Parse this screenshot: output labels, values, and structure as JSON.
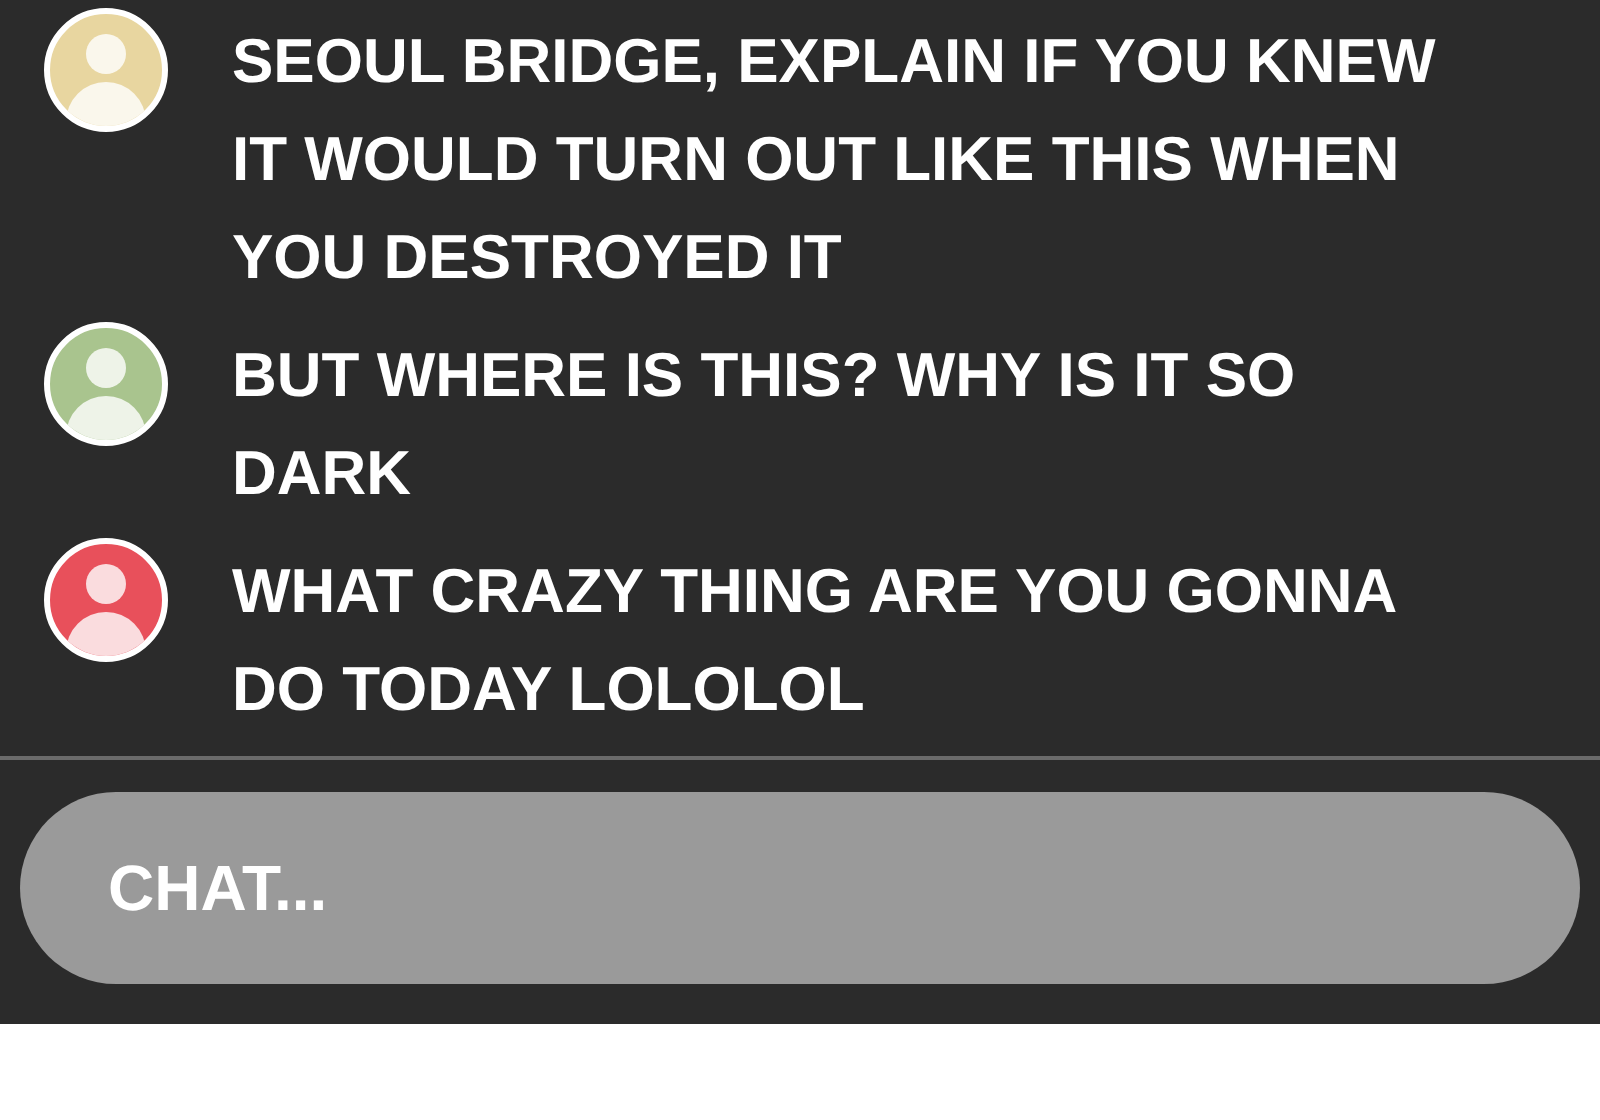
{
  "messages": [
    {
      "text": "SEOUL BRIDGE, EXPLAIN IF YOU KNEW IT WOULD TURN OUT LIKE THIS WHEN YOU DESTROYED IT",
      "color": "#e8d6a0"
    },
    {
      "text": "BUT WHERE IS THIS? WHY IS IT SO DARK",
      "color": "#a9c48e"
    },
    {
      "text": "WHAT CRAZY THING ARE YOU GONNA DO TODAY LOLOLOL",
      "color": "#e8505b"
    }
  ],
  "chat_input": {
    "placeholder": "CHAT..."
  }
}
